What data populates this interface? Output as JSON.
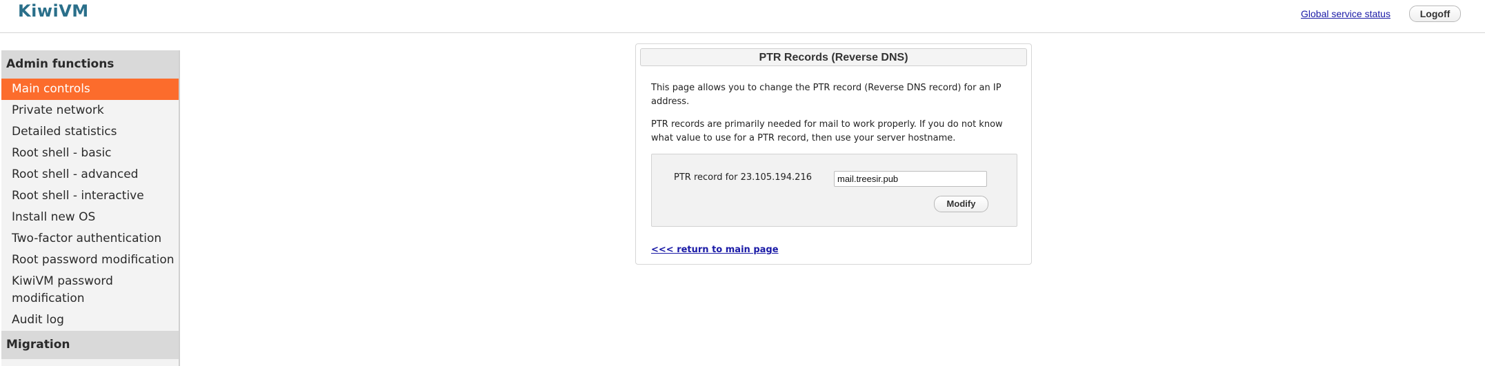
{
  "header": {
    "logo": "KiwiVM",
    "status_link": "Global service status",
    "logoff_label": "Logoff"
  },
  "sidebar": {
    "sections": [
      {
        "title": "Admin functions",
        "items": [
          "Main controls",
          "Private network",
          "Detailed statistics",
          "Root shell - basic",
          "Root shell - advanced",
          "Root shell - interactive",
          "Install new OS",
          "Two-factor authentication",
          "Root password modification",
          "KiwiVM password modification",
          "Audit log"
        ]
      },
      {
        "title": "Migration"
      }
    ],
    "active_item": "Main controls"
  },
  "panel": {
    "title": "PTR Records (Reverse DNS)",
    "intro": "This page allows you to change the PTR record (Reverse DNS record) for an IP address.",
    "note": "PTR records are primarily needed for mail to work properly. If you do not know what value to use for a PTR record, then use your server hostname.",
    "ptr_label": "PTR record for 23.105.194.216",
    "ptr_value": "mail.treesir.pub",
    "modify_label": "Modify",
    "return_link": "<<< return to main page"
  },
  "colors": {
    "accent": "#fc6c2c",
    "link": "#1a1aa6",
    "logo": "#2a6f8a"
  }
}
